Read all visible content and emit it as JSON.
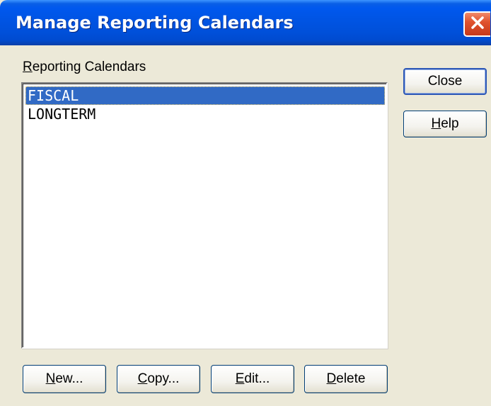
{
  "window": {
    "title": "Manage Reporting Calendars"
  },
  "list_label": "Reporting Calendars",
  "calendars": [
    {
      "label": "FISCAL",
      "selected": true
    },
    {
      "label": "LONGTERM",
      "selected": false
    }
  ],
  "buttons": {
    "close": "Close",
    "help": "Help",
    "new": "New...",
    "copy": "Copy...",
    "edit": "Edit...",
    "delete": "Delete"
  },
  "colors": {
    "title_bar": "#0054e3",
    "selection": "#316ac5",
    "dialog_bg": "#ece9d8",
    "close_button": "#e0532f"
  },
  "icons": {
    "title_close": "close-icon"
  }
}
